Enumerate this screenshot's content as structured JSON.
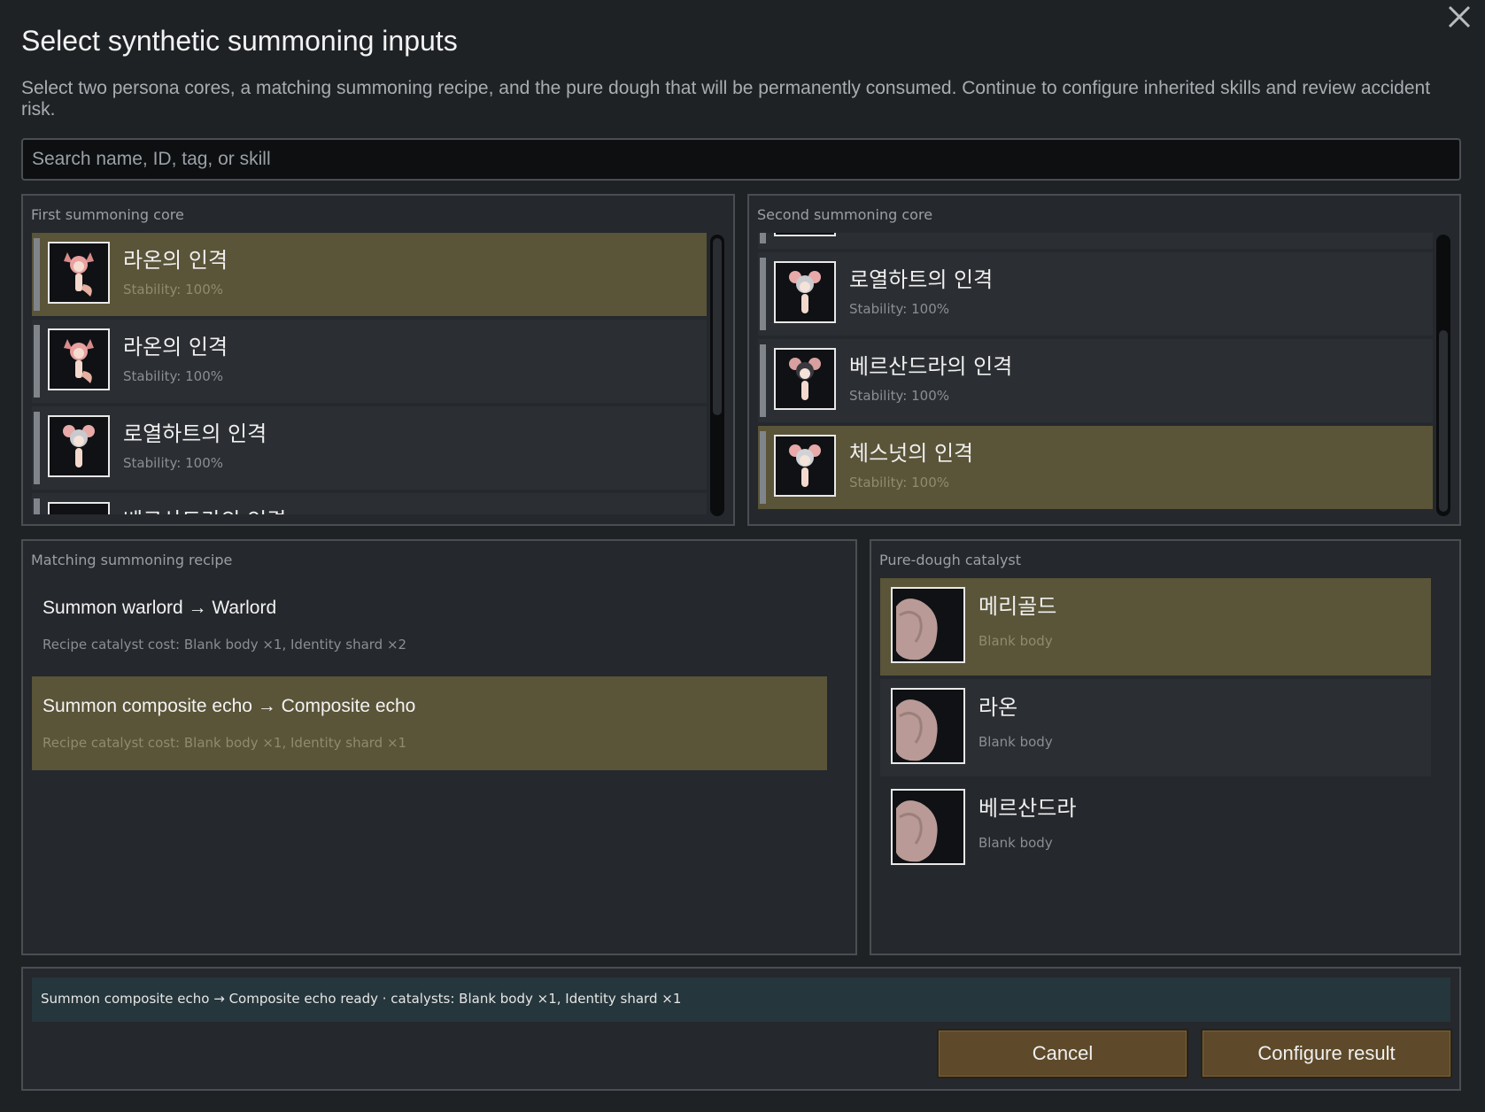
{
  "dialog": {
    "title": "Select synthetic summoning inputs",
    "description": "Select two persona cores, a matching summoning recipe, and the pure dough that will be permanently consumed. Continue to configure inherited skills and review accident risk.",
    "close_icon": "close-icon"
  },
  "search": {
    "placeholder": "Search name, ID, tag, or skill",
    "value": ""
  },
  "first_core": {
    "label": "First summoning core",
    "items": [
      {
        "name": "라온의 인격",
        "stability": "Stability: 100%",
        "selected": true
      },
      {
        "name": "라온의 인격",
        "stability": "Stability: 100%",
        "selected": false
      },
      {
        "name": "로열하트의 인격",
        "stability": "Stability: 100%",
        "selected": false
      },
      {
        "name": "베르산드라의 인격",
        "stability": "",
        "selected": false
      }
    ]
  },
  "second_core": {
    "label": "Second summoning core",
    "items": [
      {
        "name": "",
        "stability": "",
        "selected": false
      },
      {
        "name": "로열하트의 인격",
        "stability": "Stability: 100%",
        "selected": false
      },
      {
        "name": "베르산드라의 인격",
        "stability": "Stability: 100%",
        "selected": false
      },
      {
        "name": "체스넛의 인격",
        "stability": "Stability: 100%",
        "selected": true
      }
    ]
  },
  "recipes": {
    "label": "Matching summoning recipe",
    "items": [
      {
        "name": "Summon warlord → Warlord",
        "cost": "Recipe catalyst cost: Blank body ×1, Identity shard ×2",
        "selected": false
      },
      {
        "name": "Summon composite echo → Composite echo",
        "cost": "Recipe catalyst cost: Blank body ×1, Identity shard ×1",
        "selected": true
      }
    ]
  },
  "dough": {
    "label": "Pure-dough catalyst",
    "items": [
      {
        "name": "메리골드",
        "type": "Blank body",
        "selected": true
      },
      {
        "name": "라온",
        "type": "Blank body",
        "selected": false
      },
      {
        "name": "베르산드라",
        "type": "Blank body",
        "selected": false
      }
    ]
  },
  "footer": {
    "status": "Summon composite echo → Composite echo ready · catalysts: Blank body ×1, Identity shard ×1",
    "cancel_label": "Cancel",
    "configure_label": "Configure result"
  },
  "colors": {
    "background": "#1f2225",
    "panel": "#25282c",
    "selected_row": "#5a5438",
    "status_bar": "#25363c",
    "button": "#5e4a2a"
  }
}
